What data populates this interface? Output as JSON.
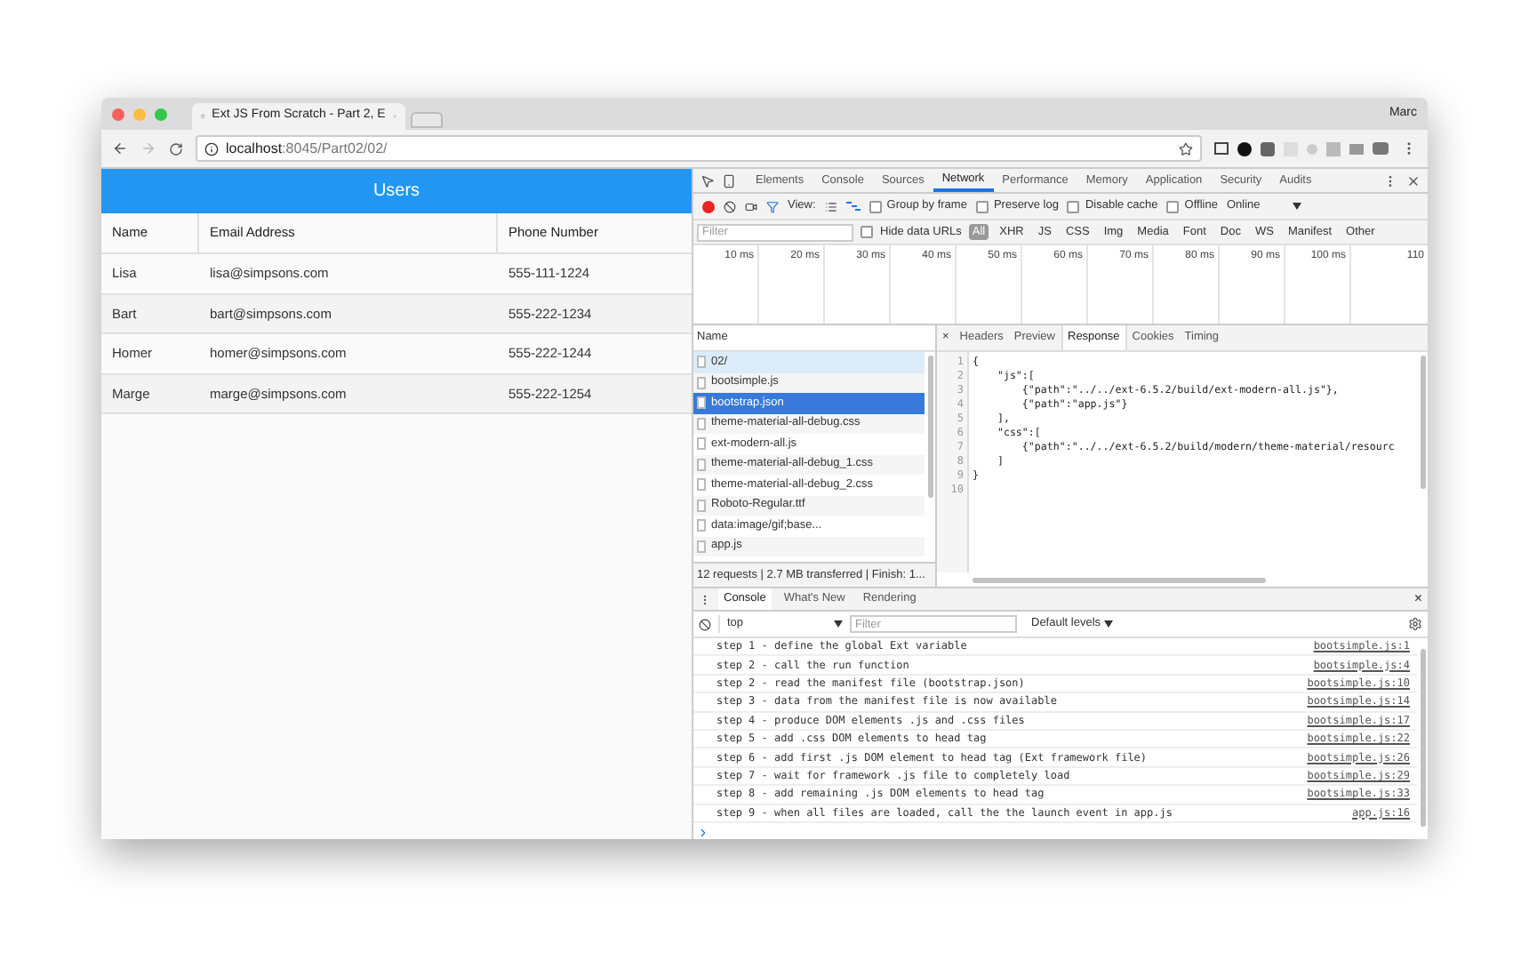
{
  "browser": {
    "tab_title": "Ext JS From Scratch - Part 2, E",
    "user": "Marc",
    "url_host": "localhost",
    "url_path": ":8045/Part02/02/"
  },
  "app": {
    "title": "Users",
    "columns": [
      "Name",
      "Email Address",
      "Phone Number"
    ],
    "rows": [
      {
        "name": "Lisa",
        "email": "lisa@simpsons.com",
        "phone": "555-111-1224"
      },
      {
        "name": "Bart",
        "email": "bart@simpsons.com",
        "phone": "555-222-1234"
      },
      {
        "name": "Homer",
        "email": "homer@simpsons.com",
        "phone": "555-222-1244"
      },
      {
        "name": "Marge",
        "email": "marge@simpsons.com",
        "phone": "555-222-1254"
      }
    ]
  },
  "devtools": {
    "tabs": [
      {
        "label": "Elements",
        "selected": false
      },
      {
        "label": "Console",
        "selected": false
      },
      {
        "label": "Sources",
        "selected": false
      },
      {
        "label": "Network",
        "selected": true
      },
      {
        "label": "Performance",
        "selected": false
      },
      {
        "label": "Memory",
        "selected": false
      },
      {
        "label": "Application",
        "selected": false
      },
      {
        "label": "Security",
        "selected": false
      },
      {
        "label": "Audits",
        "selected": false
      }
    ],
    "toolbar": {
      "view_label": "View:",
      "options": [
        {
          "label": "Group by frame",
          "checked": false
        },
        {
          "label": "Preserve log",
          "checked": false
        },
        {
          "label": "Disable cache",
          "checked": false
        },
        {
          "label": "Offline",
          "checked": false
        }
      ],
      "throttling": "Online"
    },
    "filter": {
      "placeholder": "Filter",
      "hide_data_urls": {
        "label": "Hide data URLs",
        "checked": false
      },
      "types": [
        {
          "label": "All",
          "selected": true
        },
        {
          "label": "XHR",
          "selected": false
        },
        {
          "label": "JS",
          "selected": false
        },
        {
          "label": "CSS",
          "selected": false
        },
        {
          "label": "Img",
          "selected": false
        },
        {
          "label": "Media",
          "selected": false
        },
        {
          "label": "Font",
          "selected": false
        },
        {
          "label": "Doc",
          "selected": false
        },
        {
          "label": "WS",
          "selected": false
        },
        {
          "label": "Manifest",
          "selected": false
        },
        {
          "label": "Other",
          "selected": false
        }
      ]
    },
    "timeline_ticks": [
      "10 ms",
      "20 ms",
      "30 ms",
      "40 ms",
      "50 ms",
      "60 ms",
      "70 ms",
      "80 ms",
      "90 ms",
      "100 ms",
      "110"
    ],
    "requests": {
      "header": "Name",
      "items": [
        {
          "name": "02/",
          "selected": false,
          "hovered": true
        },
        {
          "name": "bootsimple.js",
          "selected": false,
          "hovered": false
        },
        {
          "name": "bootstrap.json",
          "selected": true,
          "hovered": false
        },
        {
          "name": "theme-material-all-debug.css",
          "selected": false,
          "hovered": false
        },
        {
          "name": "ext-modern-all.js",
          "selected": false,
          "hovered": false
        },
        {
          "name": "theme-material-all-debug_1.css",
          "selected": false,
          "hovered": false
        },
        {
          "name": "theme-material-all-debug_2.css",
          "selected": false,
          "hovered": false
        },
        {
          "name": "Roboto-Regular.ttf",
          "selected": false,
          "hovered": false
        },
        {
          "name": "data:image/gif;base...",
          "selected": false,
          "hovered": false
        },
        {
          "name": "app.js",
          "selected": false,
          "hovered": false
        }
      ],
      "summary": "12 requests | 2.7 MB transferred | Finish: 1..."
    },
    "detail": {
      "close": "×",
      "tabs": [
        {
          "label": "Headers",
          "selected": false
        },
        {
          "label": "Preview",
          "selected": false
        },
        {
          "label": "Response",
          "selected": true
        },
        {
          "label": "Cookies",
          "selected": false
        },
        {
          "label": "Timing",
          "selected": false
        }
      ],
      "lines": [
        {
          "number": "1",
          "text": "{"
        },
        {
          "number": "2",
          "text": "    \"js\":["
        },
        {
          "number": "3",
          "text": "        {\"path\":\"../../ext-6.5.2/build/ext-modern-all.js\"},"
        },
        {
          "number": "4",
          "text": "        {\"path\":\"app.js\"}"
        },
        {
          "number": "5",
          "text": "    ],"
        },
        {
          "number": "6",
          "text": "    \"css\":["
        },
        {
          "number": "7",
          "text": "        {\"path\":\"../../ext-6.5.2/build/modern/theme-material/resourc"
        },
        {
          "number": "8",
          "text": "    ]"
        },
        {
          "number": "9",
          "text": "}"
        },
        {
          "number": "10"
        }
      ]
    },
    "console": {
      "tabs": [
        {
          "label": "Console",
          "selected": true
        },
        {
          "label": "What's New",
          "selected": false
        },
        {
          "label": "Rendering",
          "selected": false
        }
      ],
      "close": "×",
      "context": "top",
      "filter_placeholder": "Filter",
      "levels": "Default levels",
      "logs": [
        {
          "message": "step 1 - define the global Ext variable",
          "source": "bootsimple.js:1"
        },
        {
          "message": "step 2 - call the run function",
          "source": "bootsimple.js:4"
        },
        {
          "message": "step 2 - read the manifest file (bootstrap.json)",
          "source": "bootsimple.js:10"
        },
        {
          "message": "step 3 - data from the manifest file is now available",
          "source": "bootsimple.js:14"
        },
        {
          "message": "step 4 - produce DOM elements .js and .css files",
          "source": "bootsimple.js:17"
        },
        {
          "message": "step 5 - add .css DOM elements to head tag",
          "source": "bootsimple.js:22"
        },
        {
          "message": "step 6 - add first .js DOM element to head tag (Ext framework file)",
          "source": "bootsimple.js:26"
        },
        {
          "message": "step 7 - wait for framework .js file to completely load",
          "source": "bootsimple.js:29"
        },
        {
          "message": "step 8 - add remaining .js DOM elements to head tag",
          "source": "bootsimple.js:33"
        },
        {
          "message": "step 9 - when all files are loaded, call the the launch event in app.js",
          "source": "app.js:16"
        }
      ]
    }
  }
}
